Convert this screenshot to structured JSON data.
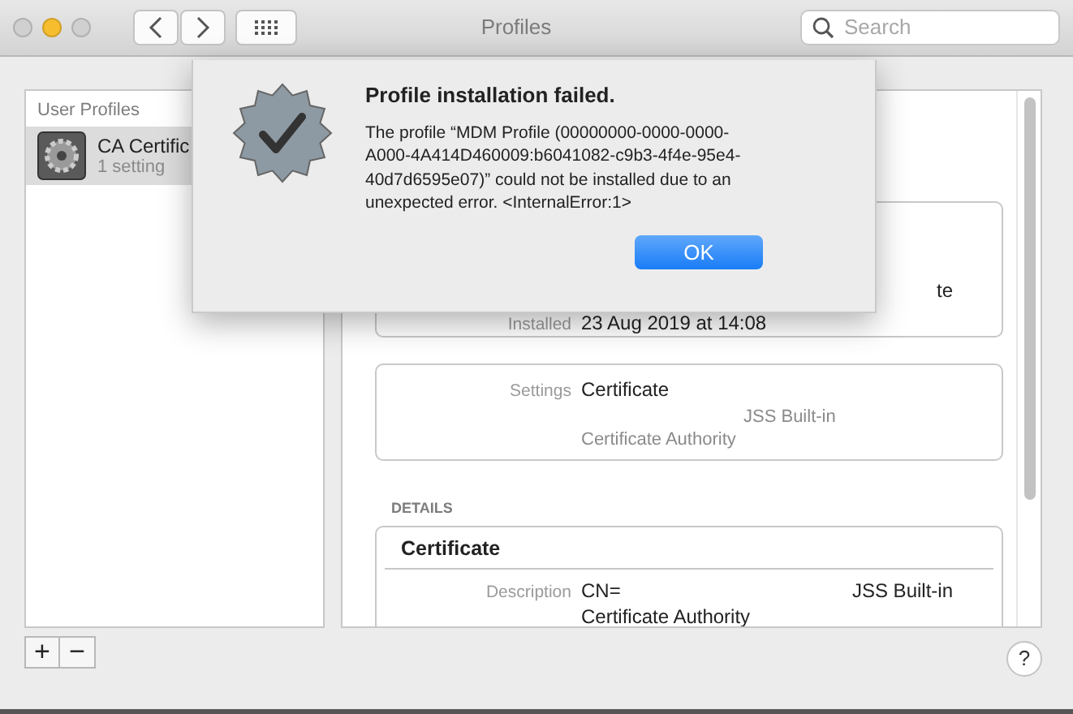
{
  "window": {
    "title": "Profiles",
    "search": {
      "placeholder": "Search"
    }
  },
  "sidebar": {
    "header": "User Profiles",
    "items": [
      {
        "name": "CA Certific",
        "subtitle": "1 setting",
        "selected": true
      }
    ]
  },
  "detail": {
    "summary_row": {
      "label": "Installed",
      "value": "23 Aug 2019 at 14:08",
      "trailing": "te"
    },
    "settings_row": {
      "label": "Settings",
      "value": "Certificate",
      "lines": [
        "JSS Built-in",
        "Certificate Authority"
      ]
    },
    "details_header": "DETAILS",
    "certificate": {
      "title": "Certificate",
      "rows": [
        {
          "label": "Description",
          "value": "CN=",
          "value_right": "JSS Built-in",
          "value_line_2": "Certificate Authority"
        }
      ]
    }
  },
  "footer": {
    "buttons": [
      "+",
      "−"
    ],
    "help": "?"
  },
  "dialog": {
    "title": "Profile installation failed.",
    "message": "The profile “MDM Profile (00000000-0000-0000-A000-4A414D460009:b6041082-c9b3-4f4e-95e4-40d7d6595e07)” could not be installed due to an unexpected error. <InternalError:1>",
    "button": "OK"
  }
}
